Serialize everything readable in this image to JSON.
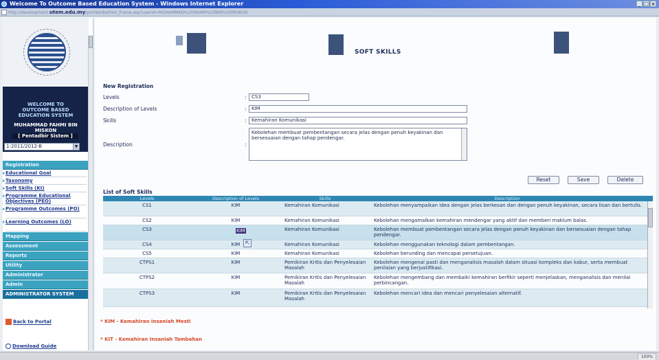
{
  "window": {
    "title": "Welcome To Outcome Based Education System - Windows Internet Explorer",
    "controls": [
      "_",
      "□",
      "×"
    ]
  },
  "address": {
    "prefix": "http://development.",
    "domain": "utem.edu.my",
    "rest": "/portal/obe/hier_frame.asp?userid=MUHAMMAD%20FAHMI%20BIN%20MISKON"
  },
  "status": {
    "zone": "100%"
  },
  "sidebar": {
    "welcome_line": "WELCOME TO\nOUTCOME BASED\nEDUCATION SYSTEM",
    "user_name": "MUHAMMAD FAHMI BIN\nMISKON",
    "role": "[ Pentadbir Sistem ]",
    "semester": "1-2011/2012-B",
    "menu": {
      "registration": "Registration",
      "items": [
        "Educational Goal",
        "Taxonomy",
        "Soft Skills (KI)",
        "Programme Educational Objectives (PEO)",
        "Programme Outcomes (PO)",
        "Learning Outcomes (LO)"
      ],
      "mapping": "Mapping",
      "assessment": "Assessment",
      "reports": "Reports",
      "utility": "Utility",
      "administrator": "Administrator",
      "admin": "Admin",
      "admin_system": "ADMINISTRATOR SYSTEM"
    },
    "back_to_portal": "Back to Portal",
    "download_guide": "Download Guide"
  },
  "main": {
    "page_title": "SOFT SKILLS",
    "form": {
      "section_title": "New Registration",
      "levels_label": "Levels",
      "levels_value": "CS3",
      "desc_levels_label": "Description of Levels",
      "desc_levels_value": "KIM",
      "skills_label": "Skills",
      "skills_value": "Kemahiran Komunikasi",
      "description_label": "Description",
      "description_value": "Kebolehan membuat pembentangan secara jelas dengan penuh keyakinan dan bersesuaian dengan tahap pendengar.",
      "colon": ":"
    },
    "buttons": {
      "reset": "Reset",
      "save": "Save",
      "delete": "Delete"
    },
    "list": {
      "title": "List of Soft Skills",
      "headers": [
        "Levels",
        "Description of Levels",
        "Skills",
        "Description"
      ],
      "rows": [
        [
          "CS1",
          "KIM",
          "Kemahiran Komunikasi",
          "Kebolehan menyampaikan idea dengan jelas berkesan dan dengan penuh keyakinan, secara lisan dan bertulis."
        ],
        [
          "CS2",
          "KIM",
          "Kemahiran Komunikasi",
          "Kebolehan mengamalkan kemahiran mendengar yang aktif dan memberi maklum balas."
        ],
        [
          "CS3",
          "KIM",
          "Kemahiran Komunikasi",
          "Kebolehan membuat pembentangan secara jelas dengan penuh keyakinan dan bersesuaian dengan tahap pendengar."
        ],
        [
          "CS4",
          "KIM",
          "Kemahiran Komunikasi",
          "Kebolehan menggunakan teknologi dalam pembentangan."
        ],
        [
          "CS5",
          "KIM",
          "Kemahiran Komunikasi",
          "Kebolehan berunding dan mencapai persetujuan."
        ],
        [
          "CTPS1",
          "KIM",
          "Pemikiran Kritis dan Penyelesaian Masalah",
          "Kebolehan mengenal pasti dan menganalisis masalah dalam situasi kompleks dan kabur, serta membuat penilaian yang berjustifikasi."
        ],
        [
          "CTPS2",
          "KIM",
          "Pemikiran Kritis dan Penyelesaian Masalah",
          "Kebolehan mengembang dan membaiki kemahiran berfikir seperti menjelaskan, menganalisis dan menilai perbincangan."
        ],
        [
          "CTPS3",
          "KIM",
          "Pemikiran Kritis dan Penyelesaian Masalah",
          "Kebolehan mencari idea dan mencari penyelesaian alternatif."
        ]
      ]
    },
    "legend": {
      "kim": "* KIM - Kemahiran Insaniah Mesti",
      "kit": "* KIT - Kemahiran Insaniah Tambahan"
    }
  }
}
